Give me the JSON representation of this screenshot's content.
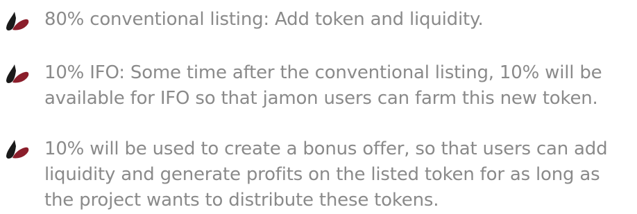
{
  "list": {
    "items": [
      {
        "text": "80% conventional listing: Add token and liquidity.",
        "icon": "leaf-bullet-icon"
      },
      {
        "text": "10% IFO: Some time after the conventional listing, 10% will be available for IFO so that jamon users can farm this new token.",
        "icon": "leaf-bullet-icon"
      },
      {
        "text": "10% will be used to create a bonus offer, so that users can add liquidity and generate profits on the listed token for as long as the project wants to distribute these tokens.",
        "icon": "leaf-bullet-icon"
      }
    ]
  },
  "colors": {
    "text": "#8a8a8a",
    "bullet_dark": "#1a1a1a",
    "bullet_red": "#8b1e2b"
  }
}
